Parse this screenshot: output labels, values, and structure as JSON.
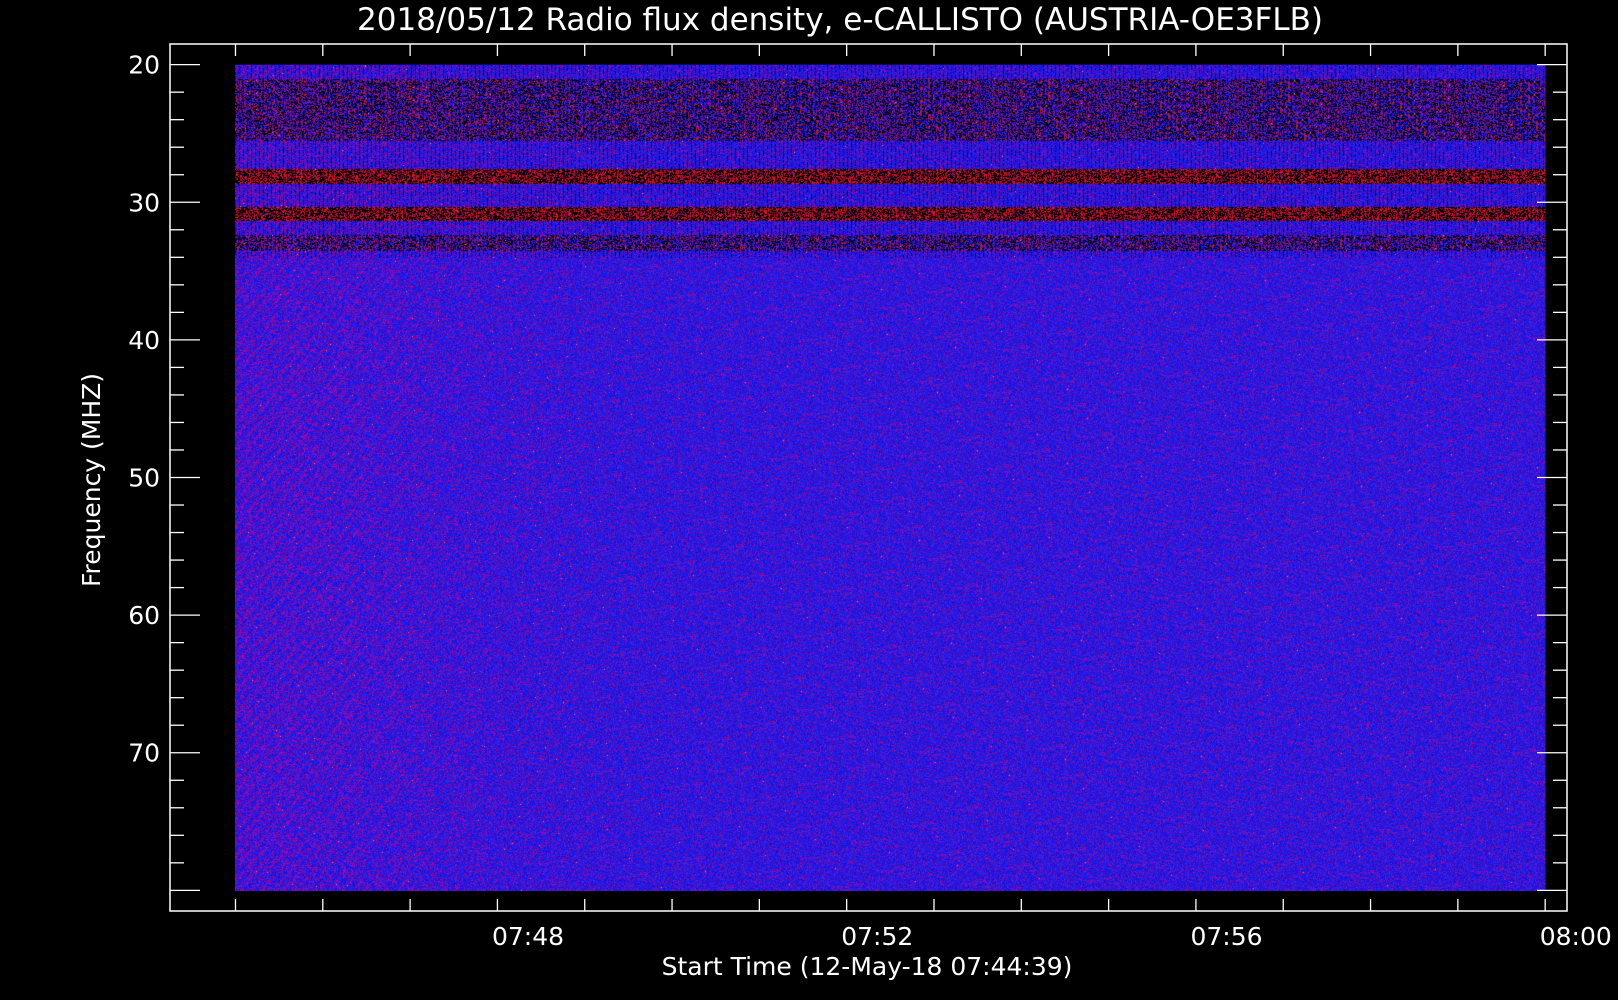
{
  "chart_data": {
    "type": "heatmap",
    "title": "2018/05/12  Radio flux density, e-CALLISTO (AUSTRIA-OE3FLB)",
    "xlabel": "Start Time (12-May-18 07:44:39)",
    "ylabel": "Frequency (MHZ)",
    "y_ticks": [
      "20",
      "30",
      "40",
      "50",
      "60",
      "70"
    ],
    "x_ticks": [
      "07:48",
      "07:52",
      "07:56",
      "08:00"
    ],
    "x_range_minutes": [
      -0.75,
      15.25
    ],
    "y_range_mhz": [
      18.5,
      81.5
    ],
    "data_x_range_minutes": [
      0,
      15
    ],
    "data_y_range_mhz": [
      20,
      80
    ],
    "colormap": [
      "#000000",
      "#2828ff",
      "#8a1a3a",
      "#ff2020"
    ],
    "background_level": "blue",
    "features": [
      {
        "name": "interference band",
        "freq_mhz": [
          27.5,
          28.6
        ],
        "intensity": "high"
      },
      {
        "name": "interference band",
        "freq_mhz": [
          30.3,
          31.3
        ],
        "intensity": "high"
      },
      {
        "name": "interference band",
        "freq_mhz": [
          21.0,
          25.5
        ],
        "intensity": "mixed"
      },
      {
        "name": "interference band",
        "freq_mhz": [
          32.3,
          33.5
        ],
        "intensity": "mixed"
      }
    ],
    "colors": {
      "background": "#000000",
      "axes": "#ffffff",
      "base": "#1e1ef0"
    }
  }
}
